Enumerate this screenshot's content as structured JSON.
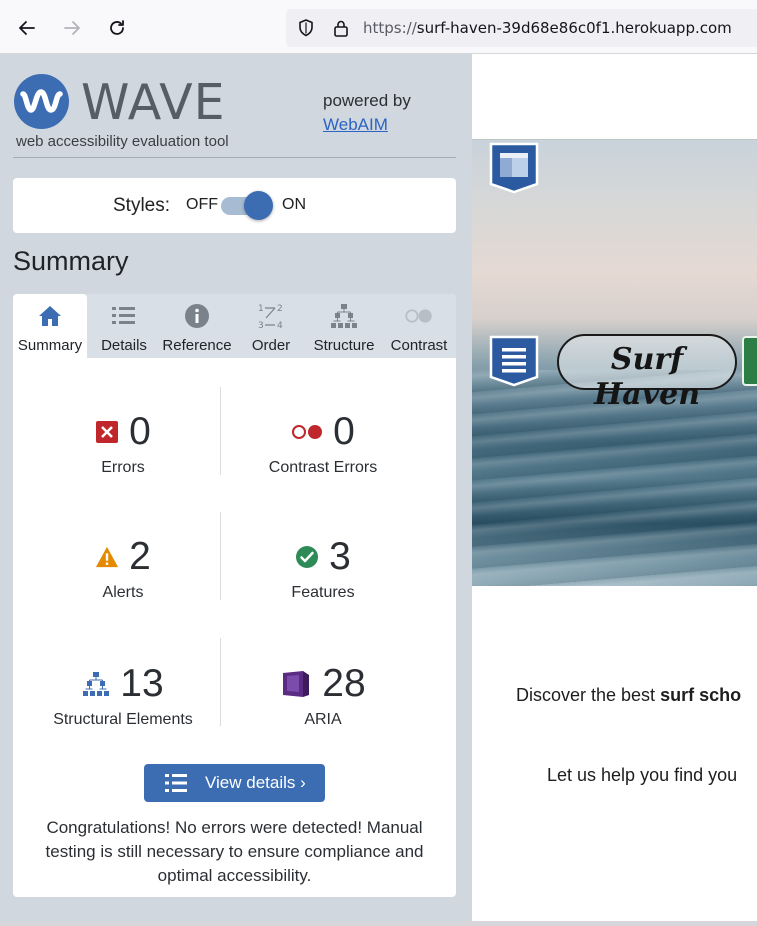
{
  "browser": {
    "url_scheme": "https://",
    "url_host": "surf-haven-39d68e86c0f1.herokuapp.com"
  },
  "wave": {
    "logo_word": "WAVE",
    "tagline": "web accessibility evaluation tool",
    "powered_by": "powered by",
    "webaim_link": "WebAIM",
    "styles_label": "Styles:",
    "styles_off": "OFF",
    "styles_on": "ON",
    "styles_enabled": true,
    "summary_heading": "Summary",
    "tabs": [
      {
        "label": "Summary",
        "icon": "home-icon",
        "active": true
      },
      {
        "label": "Details",
        "icon": "list-icon",
        "active": false
      },
      {
        "label": "Reference",
        "icon": "info-icon",
        "active": false
      },
      {
        "label": "Order",
        "icon": "order-icon",
        "active": false
      },
      {
        "label": "Structure",
        "icon": "structure-icon",
        "active": false
      },
      {
        "label": "Contrast",
        "icon": "contrast-icon",
        "active": false
      }
    ],
    "stats": {
      "errors": {
        "count": "0",
        "label": "Errors"
      },
      "contrast_errors": {
        "count": "0",
        "label": "Contrast Errors"
      },
      "alerts": {
        "count": "2",
        "label": "Alerts"
      },
      "features": {
        "count": "3",
        "label": "Features"
      },
      "structural": {
        "count": "13",
        "label": "Structural Elements"
      },
      "aria": {
        "count": "28",
        "label": "ARIA"
      }
    },
    "view_details": "View details ›",
    "congrats": "Congratulations! No errors were detected! Manual testing is still necessary to ensure compliance and optimal accessibility.",
    "colors": {
      "accent": "#3c6db3",
      "error": "#c0272d",
      "alert": "#e38a00",
      "feature": "#2e8b57",
      "aria": "#5b2c83"
    }
  },
  "preview": {
    "logo_text": "Surf Haven",
    "line1_prefix": "Discover the best ",
    "line1_bold": "surf scho",
    "line2": "Let us help you find you"
  }
}
